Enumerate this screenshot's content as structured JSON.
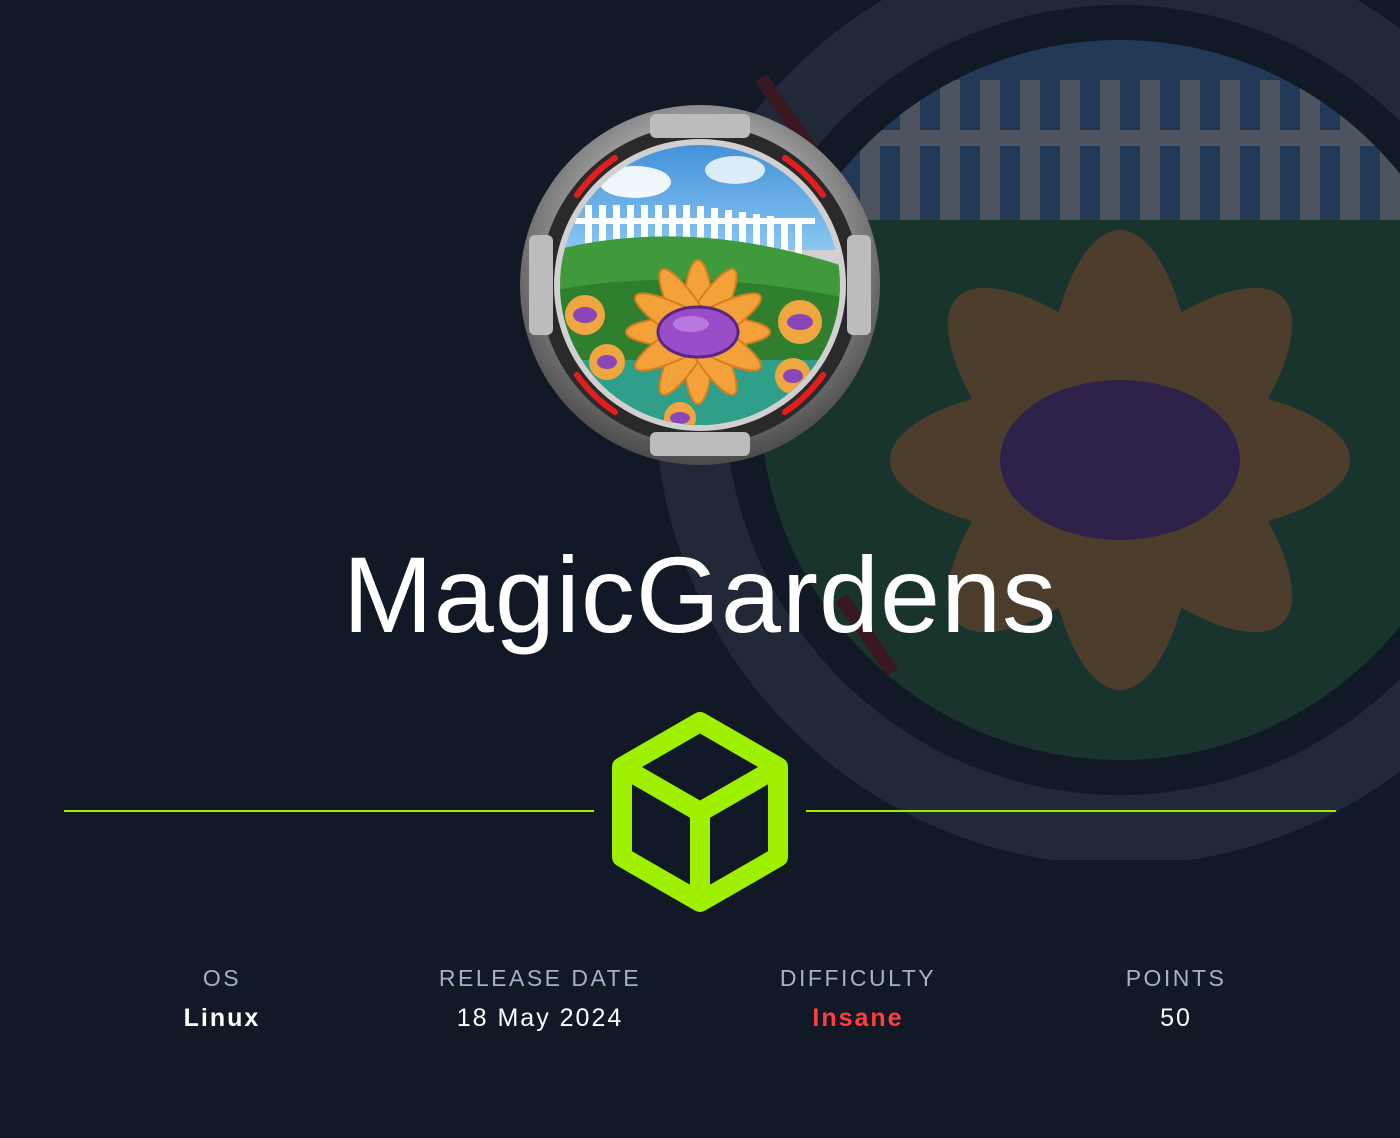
{
  "machine": {
    "name": "MagicGardens"
  },
  "stats": {
    "os_label": "OS",
    "os_value": "Linux",
    "release_label": "RELEASE DATE",
    "release_value": "18 May 2024",
    "difficulty_label": "DIFFICULTY",
    "difficulty_value": "Insane",
    "points_label": "POINTS",
    "points_value": "50"
  },
  "colors": {
    "background": "#111927",
    "accent": "#9fef00",
    "difficulty": "#ff3e3e",
    "label": "#a4b1cd"
  },
  "icons": {
    "brand_logo": "hackthebox-cube-icon",
    "machine_avatar": "garden-flower-badge"
  }
}
